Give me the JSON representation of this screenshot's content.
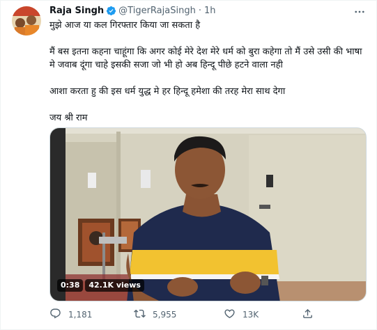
{
  "author": {
    "name": "Raja Singh",
    "handle": "@TigerRajaSingh",
    "separator": "·",
    "time": "1h"
  },
  "tweet": {
    "line1": "मुझे आज या कल गिरफ्तार किया जा सकता है",
    "para2": "मैं बस इतना कहना चाहूंगा कि अगर कोई मेरे देश मेरे धर्म को बुरा कहेगा तो मैं उसे उसी की भाषा मे जवाब दूंगा चाहे इसकी सजा जो भी हो अब हिन्दू पीछे हटने वाला नही",
    "para3": "आशा करता हु की इस धर्म युद्ध मे हर हिन्दू हमेशा की तरह मेरा साथ देगा",
    "para4": "जय श्री राम"
  },
  "video": {
    "duration": "0:38",
    "views": "42.1K views"
  },
  "actions": {
    "replies": "1,181",
    "retweets": "5,955",
    "likes": "13K"
  },
  "icons": {
    "verified": "verified-badge-icon",
    "more": "more-options-icon",
    "reply": "reply-icon",
    "retweet": "retweet-icon",
    "like": "heart-icon",
    "share": "share-icon"
  },
  "colors": {
    "verified_blue": "#1d9bf0",
    "secondary_text": "#536471",
    "primary_text": "#0f1419"
  }
}
